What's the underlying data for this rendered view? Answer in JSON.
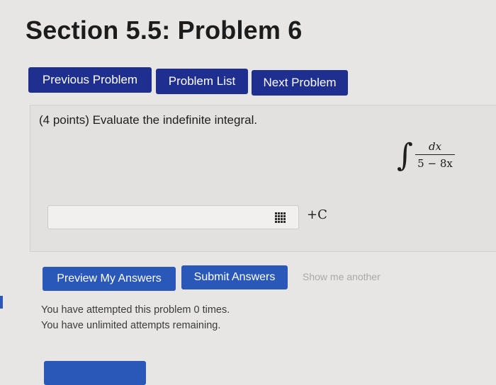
{
  "page": {
    "title": "Section 5.5: Problem 6"
  },
  "nav": {
    "previous_label": "Previous Problem",
    "list_label": "Problem List",
    "next_label": "Next Problem"
  },
  "problem": {
    "prompt": "(4 points) Evaluate the indefinite integral.",
    "integral_sign": "∫",
    "numerator": "dx",
    "denominator": "5 − 8x",
    "constant": "+C"
  },
  "answer": {
    "value": "",
    "placeholder": ""
  },
  "icons": {
    "equation_editor": "grid-icon"
  },
  "actions": {
    "preview_label": "Preview My Answers",
    "submit_label": "Submit Answers",
    "show_another_label": "Show me another"
  },
  "status": {
    "attempted": "You have attempted this problem 0 times.",
    "remaining": "You have unlimited attempts remaining."
  },
  "colors": {
    "nav_button": "#1f2f8f",
    "action_button": "#2a58b8",
    "background": "#e7e6e4"
  }
}
